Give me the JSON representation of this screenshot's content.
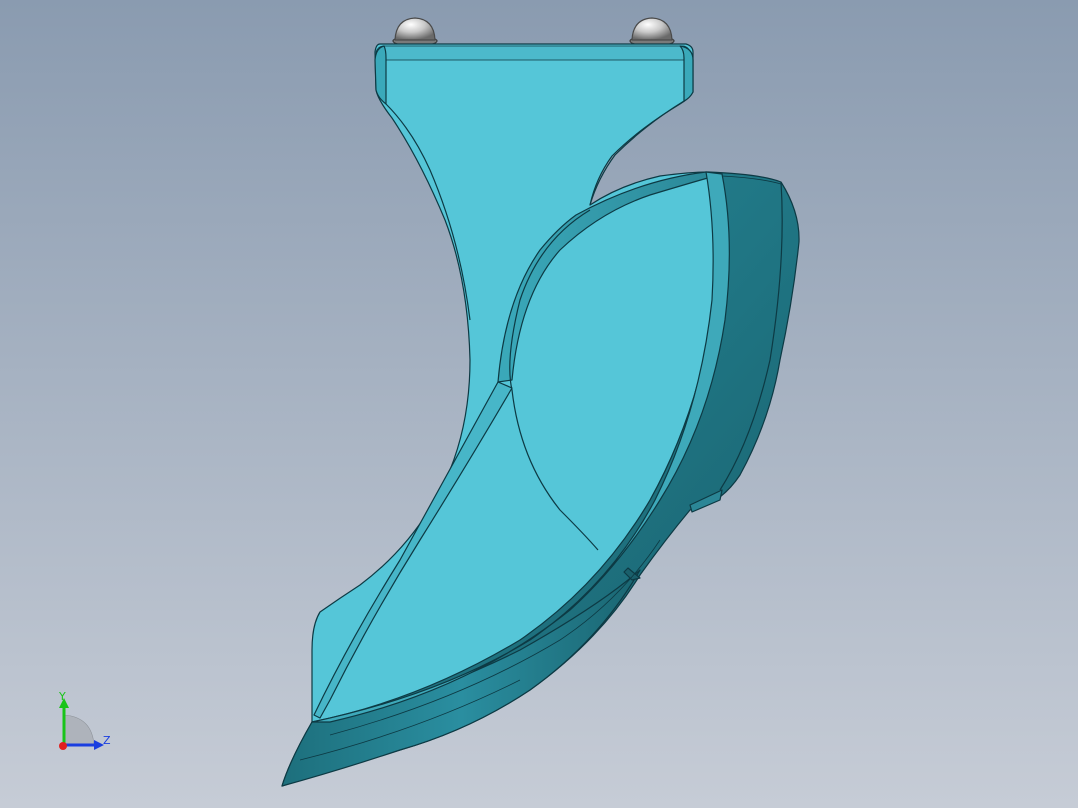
{
  "viewport": {
    "background_top": "#8a9bb0",
    "background_bottom": "#c6ccd6"
  },
  "model": {
    "name": "",
    "face_color": "#55c6d8",
    "shadow_color": "#1f7482",
    "edge_color": "#0d3a44",
    "fasteners": [
      "ball-stud-left",
      "ball-stud-right"
    ]
  },
  "triad": {
    "x_label": "",
    "y_label": "Y",
    "z_label": "Z",
    "x_color": "#e02020",
    "y_color": "#19c419",
    "z_color": "#1a3ee0"
  }
}
